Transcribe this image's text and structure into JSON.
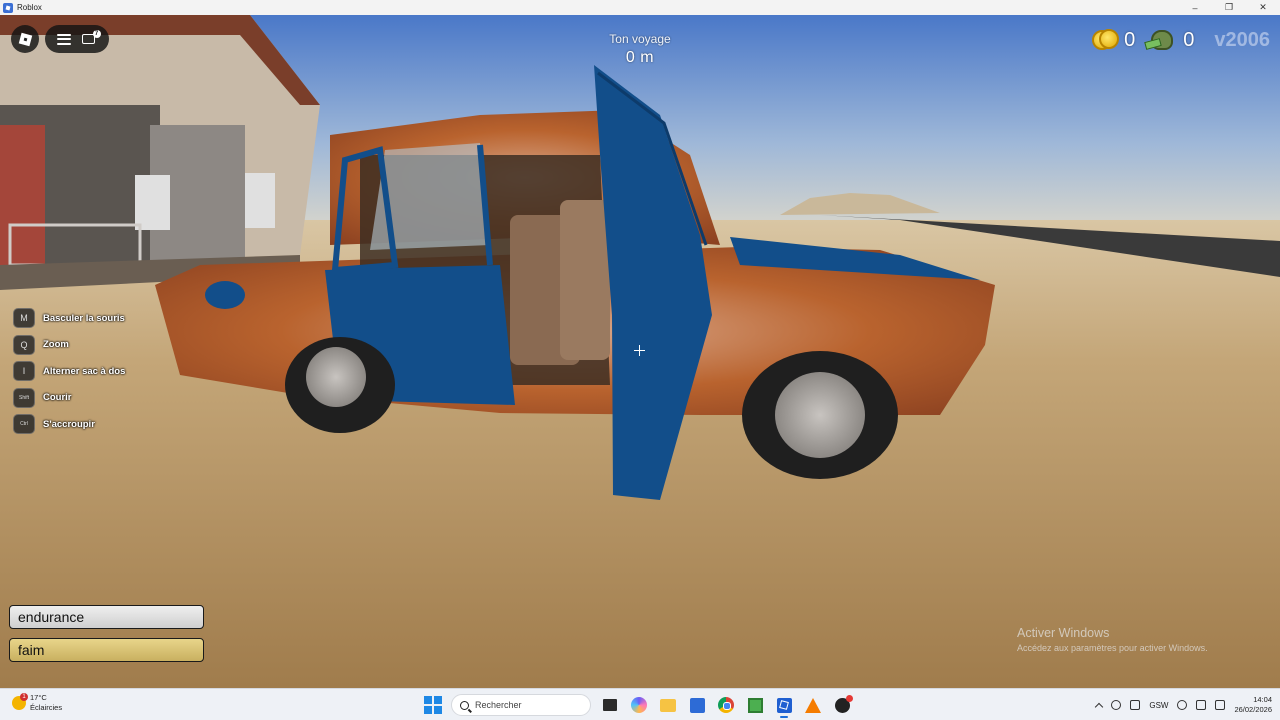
{
  "window": {
    "title": "Roblox",
    "minimize": "–",
    "maximize": "❐",
    "close": "✕"
  },
  "hud": {
    "journey_label": "Ton voyage",
    "journey_value": "0 m",
    "coins": "0",
    "money": "0",
    "version": "v2006",
    "chat_badge": "7"
  },
  "keybinds": [
    {
      "key": "M",
      "label": "Basculer la souris"
    },
    {
      "key": "Q",
      "label": "Zoom"
    },
    {
      "key": "I",
      "label": "Alterner sac à dos"
    },
    {
      "key": "Shift",
      "label": "Courir"
    },
    {
      "key": "Ctrl",
      "label": "S'accroupir"
    }
  ],
  "stats": {
    "endurance": "endurance",
    "hunger": "faim"
  },
  "watermark": {
    "line1": "Activer Windows",
    "line2": "Accédez aux paramètres pour activer Windows."
  },
  "taskbar": {
    "weather_temp": "17°C",
    "weather_desc": "Éclaircies",
    "weather_alert": "1",
    "search_placeholder": "Rechercher",
    "lang": "GSW",
    "time": "14:04",
    "date": "26/02/2026"
  },
  "colors": {
    "sky_top": "#4a78c8",
    "sand": "#b89565",
    "car_rust": "#b05a2a",
    "car_blue": "#124e8a"
  }
}
